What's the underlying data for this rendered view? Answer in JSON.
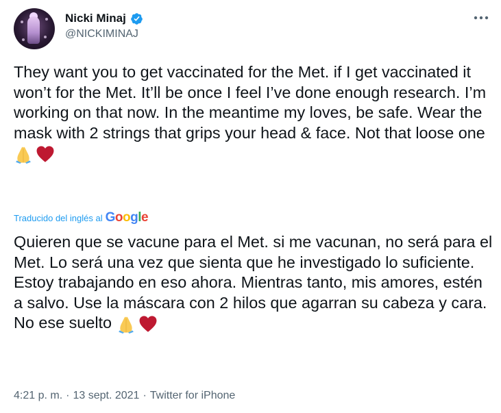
{
  "author": {
    "display_name": "Nicki Minaj",
    "handle": "@NICKIMINAJ",
    "verified": true
  },
  "tweet": {
    "text": "They want you to get vaccinated for the Met. if I get vaccinated it won’t for the Met. It’ll be once I feel I’ve done enough research. I’m working on that now. In the meantime my loves, be safe. Wear the mask with 2 strings that grips your head & face. Not that loose one",
    "emojis": [
      "folded-hands",
      "red-heart"
    ]
  },
  "translation": {
    "label": "Traducido del inglés al",
    "provider": "Google",
    "text": "Quieren que se vacune para el Met. si me vacunan, no será para el Met. Lo será una vez que sienta que he investigado lo suficiente. Estoy trabajando en eso ahora. Mientras tanto, mis amores, estén a salvo. Use la máscara con 2 hilos que agarran su cabeza y cara. No ese suelto",
    "emojis": [
      "folded-hands",
      "red-heart"
    ]
  },
  "meta": {
    "time": "4:21 p. m.",
    "separator1": "·",
    "date": "13 sept. 2021",
    "separator2": "·",
    "source": "Twitter for iPhone"
  },
  "colors": {
    "accent": "#1d9bf0",
    "text": "#0f1419",
    "secondary": "#536471"
  },
  "icons": {
    "verified": "verified-badge-icon",
    "more": "more-options-icon"
  }
}
